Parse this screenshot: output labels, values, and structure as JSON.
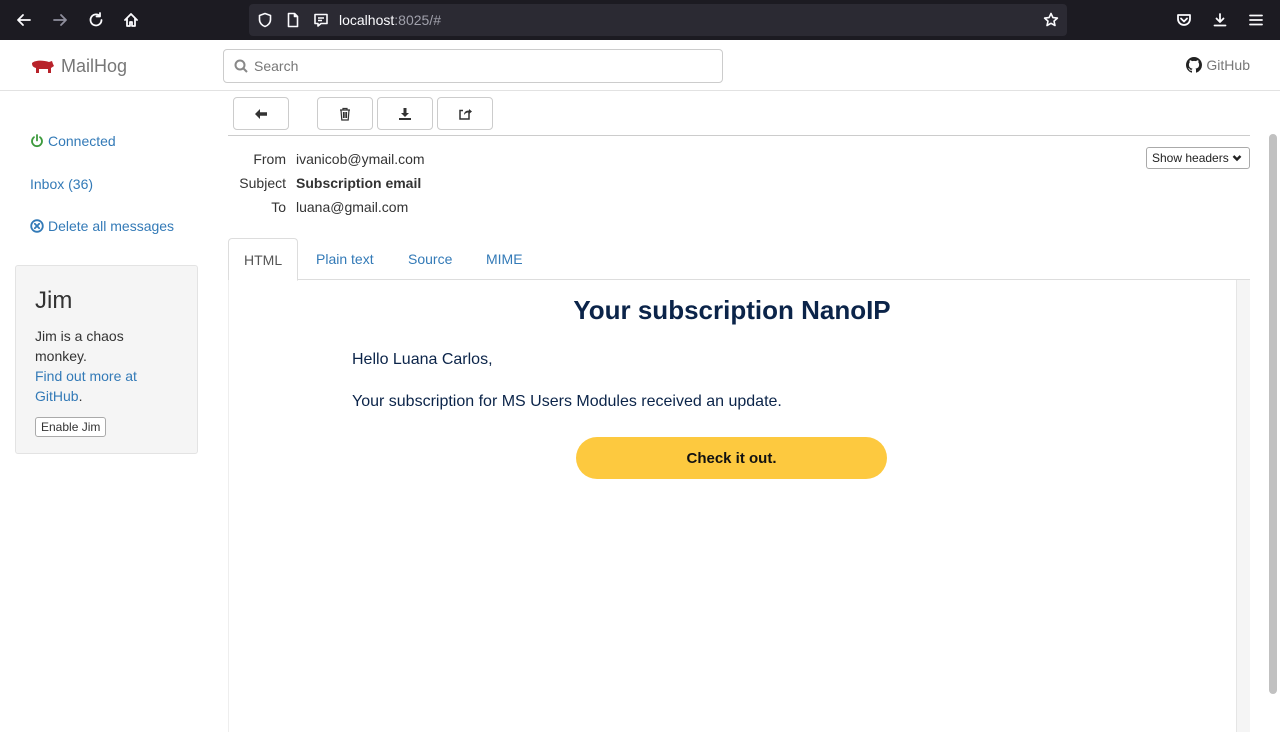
{
  "browser": {
    "url_host": "localhost",
    "url_rest": ":8025/#"
  },
  "app": {
    "brand": "MailHog",
    "search_placeholder": "Search",
    "github_label": "GitHub"
  },
  "sidebar": {
    "connected_label": "Connected",
    "inbox_label": "Inbox (36)",
    "delete_all_label": "Delete all messages",
    "jim": {
      "title": "Jim",
      "description": "Jim is a chaos monkey.",
      "link_text": "Find out more at GitHub",
      "link_suffix": ".",
      "button_label": "Enable Jim"
    }
  },
  "message": {
    "from_label": "From",
    "from_value": "ivanicob@ymail.com",
    "subject_label": "Subject",
    "subject_value": "Subscription email",
    "to_label": "To",
    "to_value": "luana@gmail.com",
    "show_headers_label": "Show headers"
  },
  "tabs": [
    {
      "label": "HTML",
      "active": true
    },
    {
      "label": "Plain text",
      "active": false
    },
    {
      "label": "Source",
      "active": false
    },
    {
      "label": "MIME",
      "active": false
    }
  ],
  "email_body": {
    "title": "Your subscription NanoIP",
    "greeting": "Hello Luana Carlos,",
    "text": "Your subscription for MS Users Modules received an update.",
    "cta_label": "Check it out."
  },
  "colors": {
    "link": "#337ab7",
    "connected": "#3c9a3c",
    "delete": "#337ab7",
    "cta_bg": "#fdc93f",
    "email_text": "#0b2449",
    "brand_icon": "#b8222a"
  }
}
